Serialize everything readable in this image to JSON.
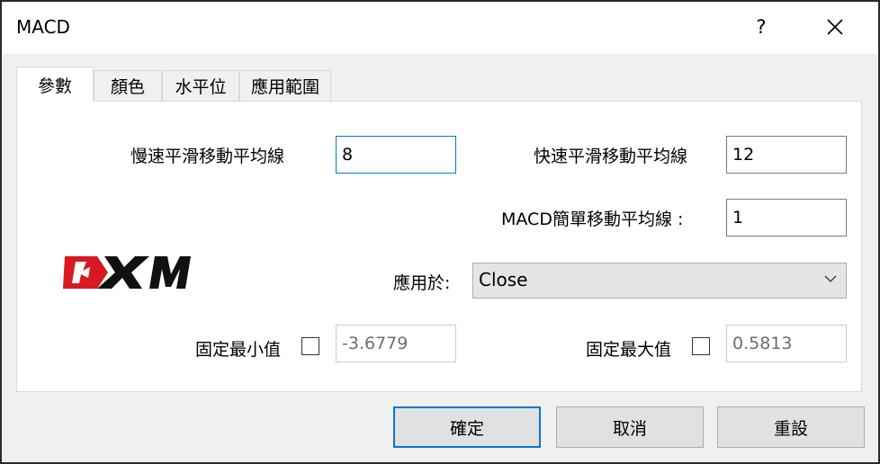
{
  "window": {
    "title": "MACD",
    "help_label": "?",
    "close_icon": "close-icon"
  },
  "tabs": [
    {
      "label": "參數",
      "active": true
    },
    {
      "label": "顏色",
      "active": false
    },
    {
      "label": "水平位",
      "active": false
    },
    {
      "label": "應用範圍",
      "active": false
    }
  ],
  "params": {
    "slow_ema_label": "慢速平滑移動平均線",
    "slow_ema_value": "8",
    "fast_ema_label": "快速平滑移動平均線",
    "fast_ema_value": "12",
    "macd_sma_label": "MACD簡單移動平均線 :",
    "macd_sma_value": "1",
    "apply_to_label": "應用於:",
    "apply_to_value": "Close",
    "fixed_min_label": "固定最小值",
    "fixed_min_value": "-3.6779",
    "fixed_min_checked": false,
    "fixed_max_label": "固定最大值",
    "fixed_max_value": "0.5813",
    "fixed_max_checked": false
  },
  "logo": {
    "text": "XM",
    "icon": "xm-logo-icon",
    "brand_color": "#d71920"
  },
  "buttons": {
    "ok": "確定",
    "cancel": "取消",
    "reset": "重設"
  },
  "colors": {
    "accent": "#0078d7"
  }
}
